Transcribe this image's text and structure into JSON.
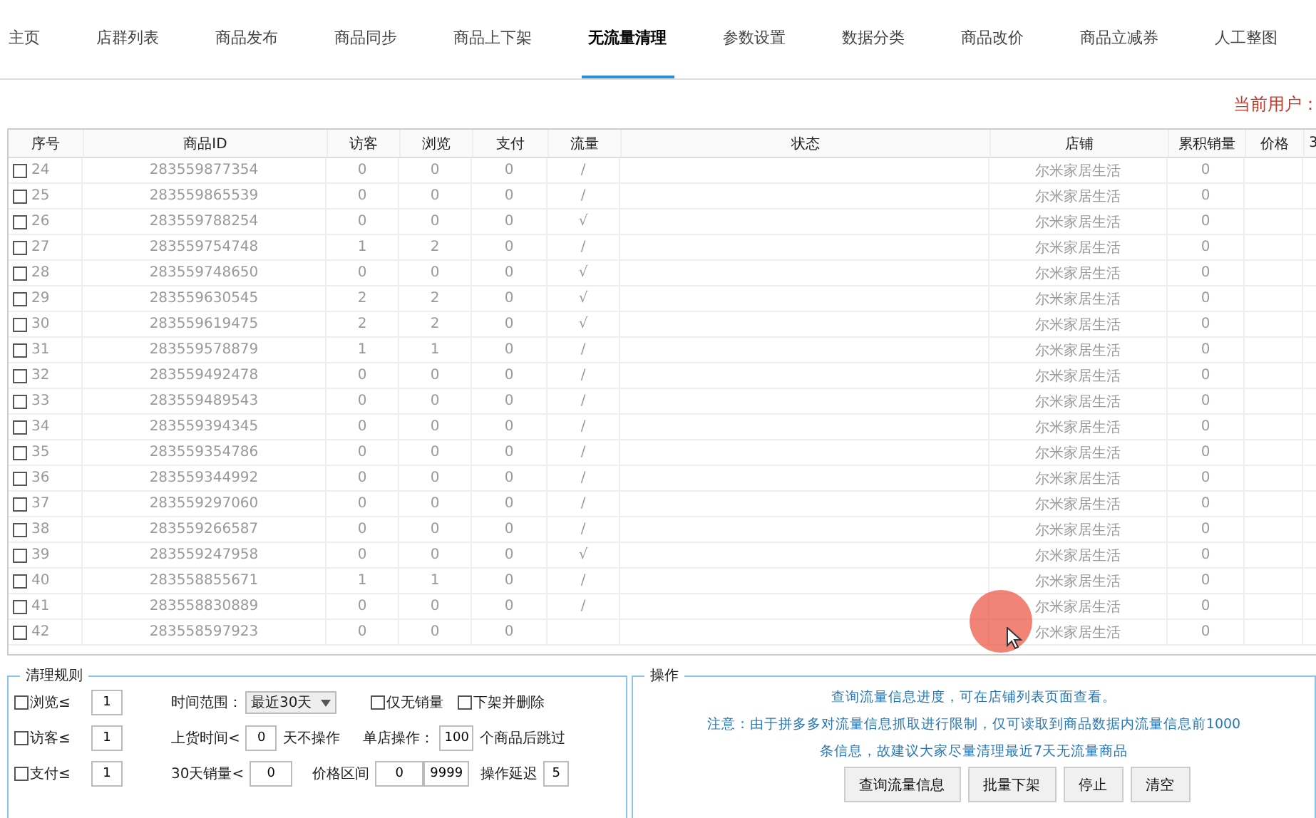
{
  "tabs": [
    {
      "label": "主页",
      "selected": false
    },
    {
      "label": "店群列表",
      "selected": false
    },
    {
      "label": "商品发布",
      "selected": false
    },
    {
      "label": "商品同步",
      "selected": false
    },
    {
      "label": "商品上下架",
      "selected": false
    },
    {
      "label": "无流量清理",
      "selected": true
    },
    {
      "label": "参数设置",
      "selected": false
    },
    {
      "label": "数据分类",
      "selected": false
    },
    {
      "label": "商品改价",
      "selected": false
    },
    {
      "label": "商品立减券",
      "selected": false
    },
    {
      "label": "人工整图",
      "selected": false
    }
  ],
  "current_user": "当前用户：",
  "table": {
    "columns": [
      "序号",
      "商品ID",
      "访客",
      "浏览",
      "支付",
      "流量",
      "状态",
      "店铺",
      "累积销量",
      "价格",
      "3"
    ],
    "rows": [
      {
        "no": "24",
        "id": "283559877354",
        "visitors": "0",
        "views": "0",
        "pay": "0",
        "flow": "/",
        "store": "尔米家居生活",
        "sales": "0",
        "checked": false
      },
      {
        "no": "25",
        "id": "283559865539",
        "visitors": "0",
        "views": "0",
        "pay": "0",
        "flow": "/",
        "store": "尔米家居生活",
        "sales": "0",
        "checked": false
      },
      {
        "no": "26",
        "id": "283559788254",
        "visitors": "0",
        "views": "0",
        "pay": "0",
        "flow": "√",
        "store": "尔米家居生活",
        "sales": "0",
        "checked": false
      },
      {
        "no": "27",
        "id": "283559754748",
        "visitors": "1",
        "views": "2",
        "pay": "0",
        "flow": "/",
        "store": "尔米家居生活",
        "sales": "0",
        "checked": false
      },
      {
        "no": "28",
        "id": "283559748650",
        "visitors": "0",
        "views": "0",
        "pay": "0",
        "flow": "√",
        "store": "尔米家居生活",
        "sales": "0",
        "checked": false
      },
      {
        "no": "29",
        "id": "283559630545",
        "visitors": "2",
        "views": "2",
        "pay": "0",
        "flow": "√",
        "store": "尔米家居生活",
        "sales": "0",
        "checked": false
      },
      {
        "no": "30",
        "id": "283559619475",
        "visitors": "2",
        "views": "2",
        "pay": "0",
        "flow": "√",
        "store": "尔米家居生活",
        "sales": "0",
        "checked": false
      },
      {
        "no": "31",
        "id": "283559578879",
        "visitors": "1",
        "views": "1",
        "pay": "0",
        "flow": "/",
        "store": "尔米家居生活",
        "sales": "0",
        "checked": false
      },
      {
        "no": "32",
        "id": "283559492478",
        "visitors": "0",
        "views": "0",
        "pay": "0",
        "flow": "/",
        "store": "尔米家居生活",
        "sales": "0",
        "checked": false
      },
      {
        "no": "33",
        "id": "283559489543",
        "visitors": "0",
        "views": "0",
        "pay": "0",
        "flow": "/",
        "store": "尔米家居生活",
        "sales": "0",
        "checked": false
      },
      {
        "no": "34",
        "id": "283559394345",
        "visitors": "0",
        "views": "0",
        "pay": "0",
        "flow": "/",
        "store": "尔米家居生活",
        "sales": "0",
        "checked": false
      },
      {
        "no": "35",
        "id": "283559354786",
        "visitors": "0",
        "views": "0",
        "pay": "0",
        "flow": "/",
        "store": "尔米家居生活",
        "sales": "0",
        "checked": false
      },
      {
        "no": "36",
        "id": "283559344992",
        "visitors": "0",
        "views": "0",
        "pay": "0",
        "flow": "/",
        "store": "尔米家居生活",
        "sales": "0",
        "checked": false
      },
      {
        "no": "37",
        "id": "283559297060",
        "visitors": "0",
        "views": "0",
        "pay": "0",
        "flow": "/",
        "store": "尔米家居生活",
        "sales": "0",
        "checked": false
      },
      {
        "no": "38",
        "id": "283559266587",
        "visitors": "0",
        "views": "0",
        "pay": "0",
        "flow": "/",
        "store": "尔米家居生活",
        "sales": "0",
        "checked": false
      },
      {
        "no": "39",
        "id": "283559247958",
        "visitors": "0",
        "views": "0",
        "pay": "0",
        "flow": "√",
        "store": "尔米家居生活",
        "sales": "0",
        "checked": false
      },
      {
        "no": "40",
        "id": "283558855671",
        "visitors": "1",
        "views": "1",
        "pay": "0",
        "flow": "/",
        "store": "尔米家居生活",
        "sales": "0",
        "checked": false
      },
      {
        "no": "41",
        "id": "283558830889",
        "visitors": "0",
        "views": "0",
        "pay": "0",
        "flow": "/",
        "store": "尔米家居生活",
        "sales": "0",
        "checked": false
      },
      {
        "no": "42",
        "id": "283558597923",
        "visitors": "0",
        "views": "0",
        "pay": "0",
        "store": "尔米家居生活",
        "sales": "0",
        "checked": false
      }
    ]
  },
  "rules": {
    "title": "清理规则",
    "limits": [
      {
        "label": "浏览≤",
        "value": "1",
        "checked": false
      },
      {
        "label": "访客≤",
        "value": "1",
        "checked": false
      },
      {
        "label": "支付≤",
        "value": "1",
        "checked": false
      }
    ],
    "time_range": {
      "label": "时间范围：",
      "value": "最近30天"
    },
    "only_no_sales": {
      "label": "仅无销量",
      "checked": false
    },
    "delist_delete": {
      "label": "下架并删除",
      "checked": false
    },
    "listing_time": {
      "label": "上货时间<",
      "value": "0",
      "suffix": "天不操作"
    },
    "per_store": {
      "label": "单店操作：",
      "value": "100",
      "suffix": "个商品后跳过"
    },
    "sales_30d": {
      "label": "30天销量<",
      "value": "0"
    },
    "price_range": {
      "label": "价格区间",
      "min": "0",
      "max": "9999"
    },
    "delay": {
      "label": "操作延迟",
      "value": "5"
    }
  },
  "operations": {
    "title": "操作",
    "notes": [
      "查询流量信息进度，可在店铺列表页面查看。",
      "注意：由于拼多多对流量信息抓取进行限制，仅可读取到商品数据内流量信息前1000",
      "条信息，故建议大家尽量清理最近7天无流量商品"
    ],
    "buttons": [
      "查询流量信息",
      "批量下架",
      "停止",
      "清空"
    ]
  }
}
